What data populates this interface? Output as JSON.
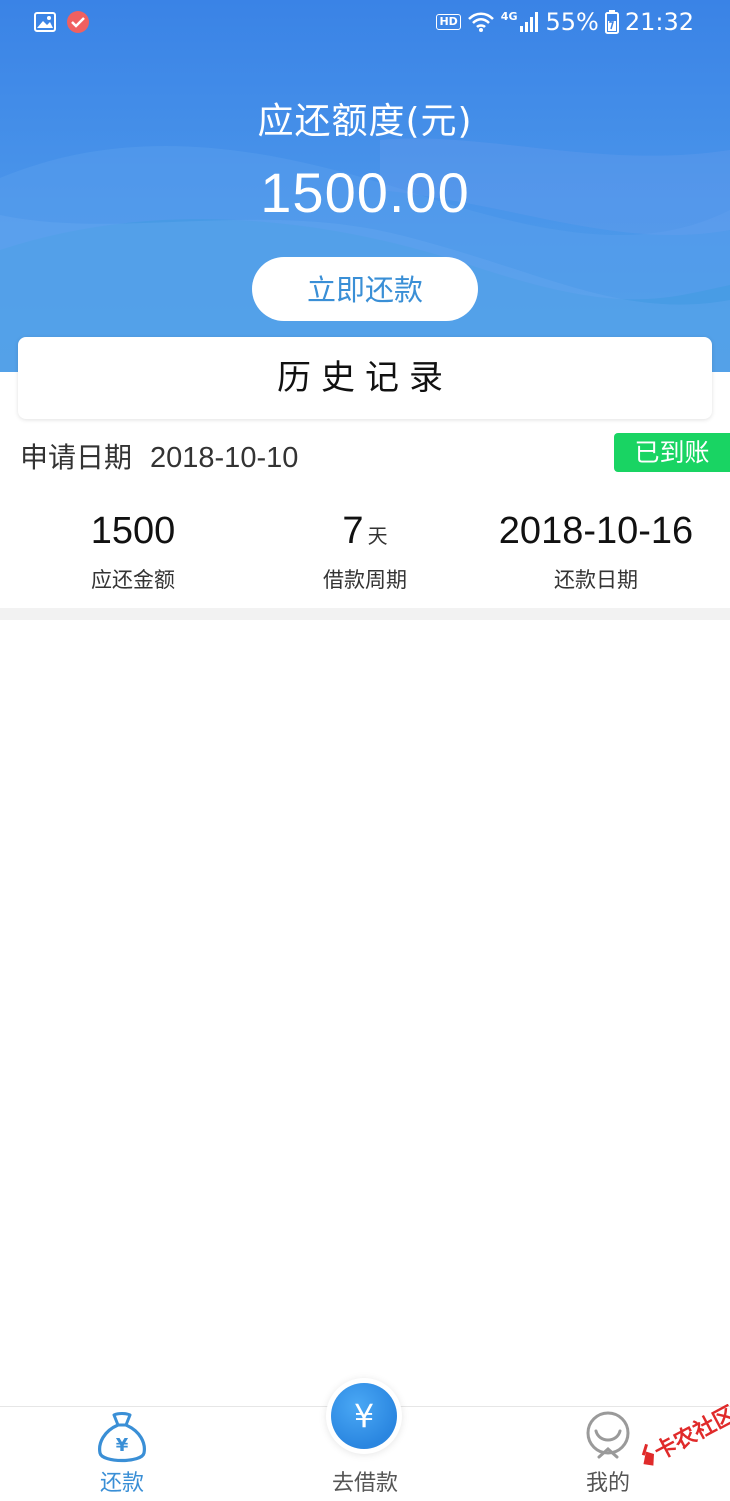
{
  "status_bar": {
    "hd_label": "HD",
    "network_label": "4G",
    "battery": "55%",
    "time": "21:32"
  },
  "header": {
    "title": "应还额度(元)",
    "amount": "1500.00",
    "repay_button_label": "立即还款"
  },
  "history": {
    "title": "历史记录"
  },
  "record": {
    "apply_label": "申请日期",
    "apply_date": "2018-10-10",
    "status_tag": "已到账",
    "stats": [
      {
        "value": "1500",
        "unit": "",
        "label": "应还金额"
      },
      {
        "value": "7",
        "unit": "天",
        "label": "借款周期"
      },
      {
        "value": "2018-10-16",
        "unit": "",
        "label": "还款日期"
      }
    ]
  },
  "bottom_nav": {
    "items": [
      {
        "label": "还款",
        "icon": "money-bag-icon",
        "active": true
      },
      {
        "label": "去借款",
        "icon": "yen-icon",
        "active": false
      },
      {
        "label": "我的",
        "icon": "user-icon",
        "active": false
      }
    ],
    "fab_symbol": "¥"
  },
  "watermark": {
    "text": "卡农社区"
  },
  "colors": {
    "accent": "#3a8fd6",
    "header_blue": "#3a83e6",
    "success_green": "#19d463"
  }
}
